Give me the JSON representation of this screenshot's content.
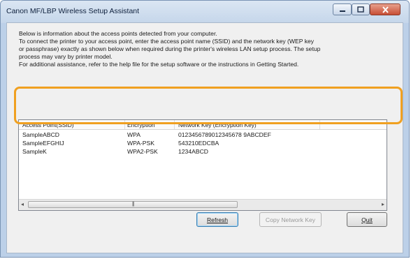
{
  "window": {
    "title": "Canon MF/LBP Wireless Setup Assistant"
  },
  "description": [
    "Below is information about the access points detected from your computer.",
    "To connect the printer to your access point, enter the access point name (SSID) and the network key (WEP key",
    "or passphrase) exactly as shown below when required during the printer's wireless LAN setup process. The setup",
    "process may vary by printer model.",
    "For additional assistance, refer to the help file for the setup software or the instructions in Getting Started."
  ],
  "table": {
    "headers": [
      "Access Point(SSID)",
      "Encryption",
      "Network Key (Encryption Key)"
    ],
    "rows": [
      {
        "ssid": "SampleABCD",
        "encryption": "WPA",
        "key": "0123456789012345678 9ABCDEF"
      },
      {
        "ssid": "SampleEFGHIJ",
        "encryption": "WPA-PSK",
        "key": "543210EDCBA"
      },
      {
        "ssid": "SampleK",
        "encryption": "WPA2-PSK",
        "key": "1234ABCD"
      }
    ],
    "scrollbar": {
      "left_arrow": "◂",
      "right_arrow": "▸",
      "grip": "|||"
    }
  },
  "buttons": {
    "refresh": "Refresh",
    "copy_key": "Copy Network Key",
    "quit": "Quit"
  },
  "colors": {
    "highlight": "#f0a020",
    "close_button": "#c74e35"
  }
}
